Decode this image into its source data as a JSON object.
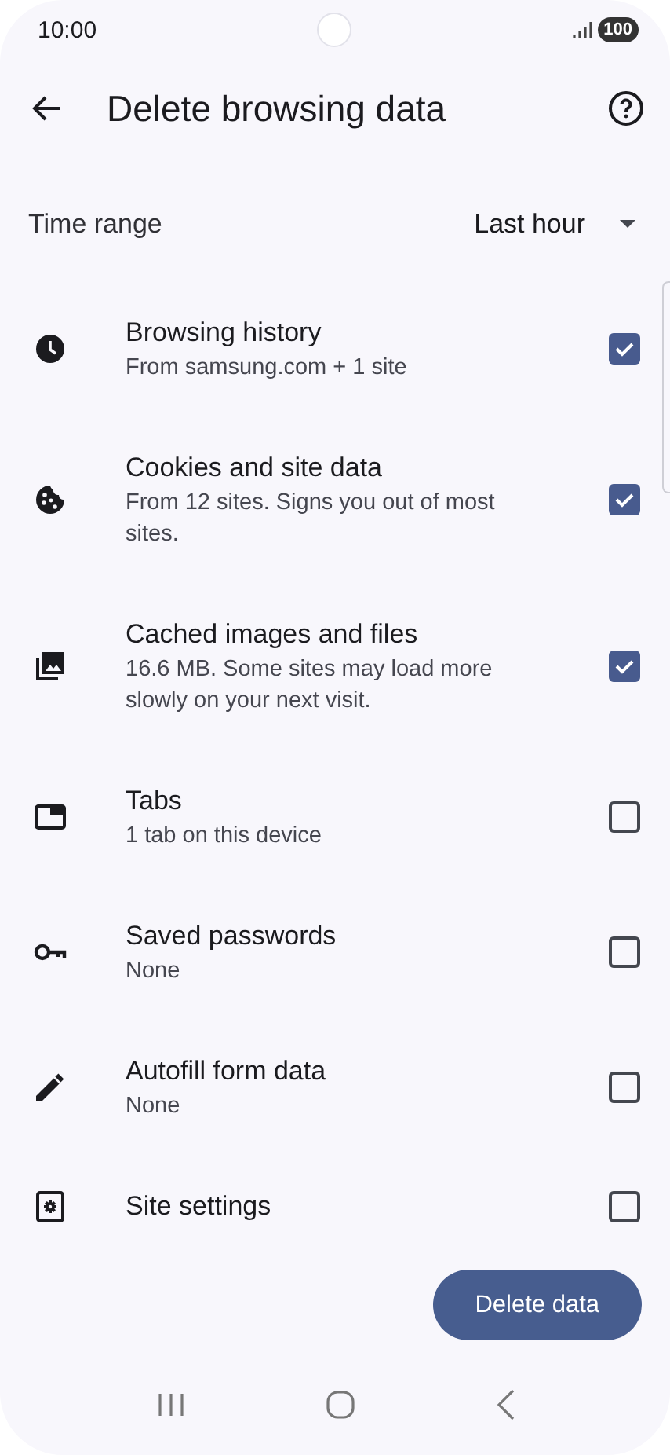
{
  "status_bar": {
    "time": "10:00",
    "battery": "100"
  },
  "header": {
    "title": "Delete browsing data"
  },
  "time_range": {
    "label": "Time range",
    "value": "Last hour"
  },
  "items": [
    {
      "title": "Browsing history",
      "subtitle": "From samsung.com + 1 site",
      "checked": true
    },
    {
      "title": "Cookies and site data",
      "subtitle": "From 12 sites. Signs you out of most sites.",
      "checked": true
    },
    {
      "title": "Cached images and files",
      "subtitle": "16.6 MB. Some sites may load more slowly on your next visit.",
      "checked": true
    },
    {
      "title": "Tabs",
      "subtitle": "1 tab on this device",
      "checked": false
    },
    {
      "title": "Saved passwords",
      "subtitle": "None",
      "checked": false
    },
    {
      "title": "Autofill form data",
      "subtitle": "None",
      "checked": false
    },
    {
      "title": "Site settings",
      "checked": false
    }
  ],
  "action": {
    "label": "Delete data"
  }
}
